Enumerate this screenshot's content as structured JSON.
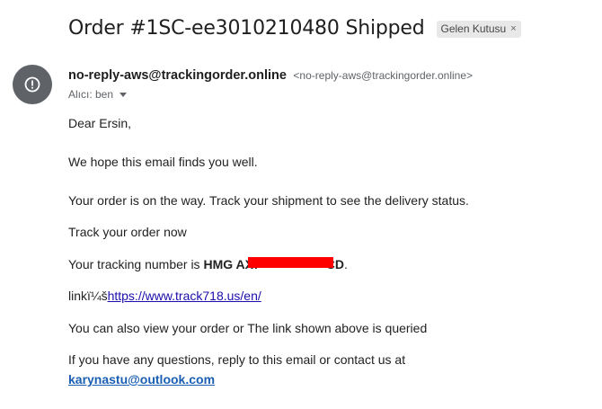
{
  "email": {
    "subject": "Order #1SC-ee3010210480 Shipped",
    "label_chip": {
      "text": "Gelen Kutusu",
      "close_glyph": "×"
    },
    "sender": {
      "name": "no-reply-aws@trackingorder.online",
      "email": "<no-reply-aws@trackingorder.online>",
      "avatar_icon": "report-icon",
      "avatar_color": "#5f6368"
    },
    "recipient": {
      "text": "Alıcı: ben",
      "dropdown_icon": "caret-down-icon"
    }
  },
  "body": {
    "greeting": "Dear Ersin,",
    "wellwish": "We hope this email finds you well.",
    "on_the_way": "Your order is on the way. Track your shipment to see the delivery status.",
    "track_now": "Track your order now",
    "tracking_prefix": "Your tracking number is ",
    "tracking_number_start": "HMG AX7",
    "tracking_number_end": "CD",
    "tracking_suffix": ".",
    "redaction_color": "#ff0000",
    "link_prefix": "linkï¼š",
    "link_url": "https://www.track718.us/en/",
    "also_view": "You can also view your order or The link shown above is queried",
    "questions": "If you have any questions, reply to this email or contact us at",
    "contact_email": "karynastu@outlook.com"
  }
}
